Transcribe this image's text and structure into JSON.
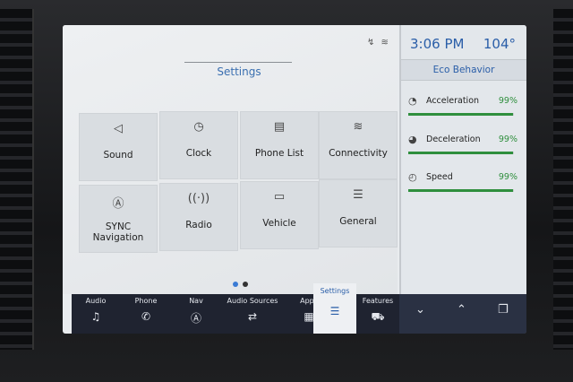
{
  "status": {
    "icons": "↯ ≋",
    "time": "3:06 PM",
    "temperature": "104°"
  },
  "settings": {
    "title": "Settings",
    "tiles": [
      {
        "label": "Sound",
        "icon": "◁"
      },
      {
        "label": "Clock",
        "icon": "◷"
      },
      {
        "label": "Phone List",
        "icon": "▤"
      },
      {
        "label": "Connectivity",
        "icon": "≋"
      },
      {
        "label": "SYNC Navigation",
        "icon": "Ⓐ"
      },
      {
        "label": "Radio",
        "icon": "((·))"
      },
      {
        "label": "Vehicle",
        "icon": "▭"
      },
      {
        "label": "General",
        "icon": "☰"
      }
    ],
    "page_dots": {
      "active": "#3a7bd5",
      "inactive": "#333333"
    }
  },
  "eco": {
    "title": "Eco Behavior",
    "rows": [
      {
        "label": "Acceleration",
        "value": "99%",
        "fraction": 0.99,
        "icon": "◔"
      },
      {
        "label": "Deceleration",
        "value": "99%",
        "fraction": 0.99,
        "icon": "◕"
      },
      {
        "label": "Speed",
        "value": "99%",
        "fraction": 0.99,
        "icon": "◴"
      }
    ]
  },
  "nav": {
    "items": [
      {
        "label": "Audio",
        "icon": "♫"
      },
      {
        "label": "Phone",
        "icon": "✆"
      },
      {
        "label": "Nav",
        "icon": "Ⓐ"
      },
      {
        "label": "Audio Sources",
        "icon": "⇄"
      },
      {
        "label": "Apps",
        "icon": "▦"
      },
      {
        "label": "Settings",
        "icon": "☰"
      },
      {
        "label": "Features",
        "icon": "⛟"
      }
    ],
    "right_icons": [
      "⌄",
      "⌃",
      "❐"
    ]
  }
}
